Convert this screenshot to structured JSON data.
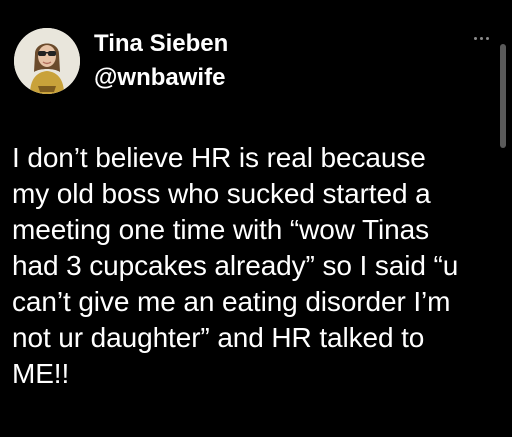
{
  "tweet": {
    "author": {
      "display_name": "Tina Sieben",
      "handle": "@wnbawife",
      "avatar_icon": "user-avatar-photo"
    },
    "more_icon": "more-options-icon",
    "text_lines": [
      "I don’t believe HR is real because",
      "my old boss who sucked started a",
      "meeting one time with “wow Tinas",
      "had 3 cupcakes already” so I said “u",
      "can’t give me an eating disorder I’m",
      "not ur daughter” and HR talked to",
      "ME!!"
    ]
  },
  "colors": {
    "background": "#000000",
    "text": "#ffffff",
    "muted": "#8b8b8b"
  }
}
